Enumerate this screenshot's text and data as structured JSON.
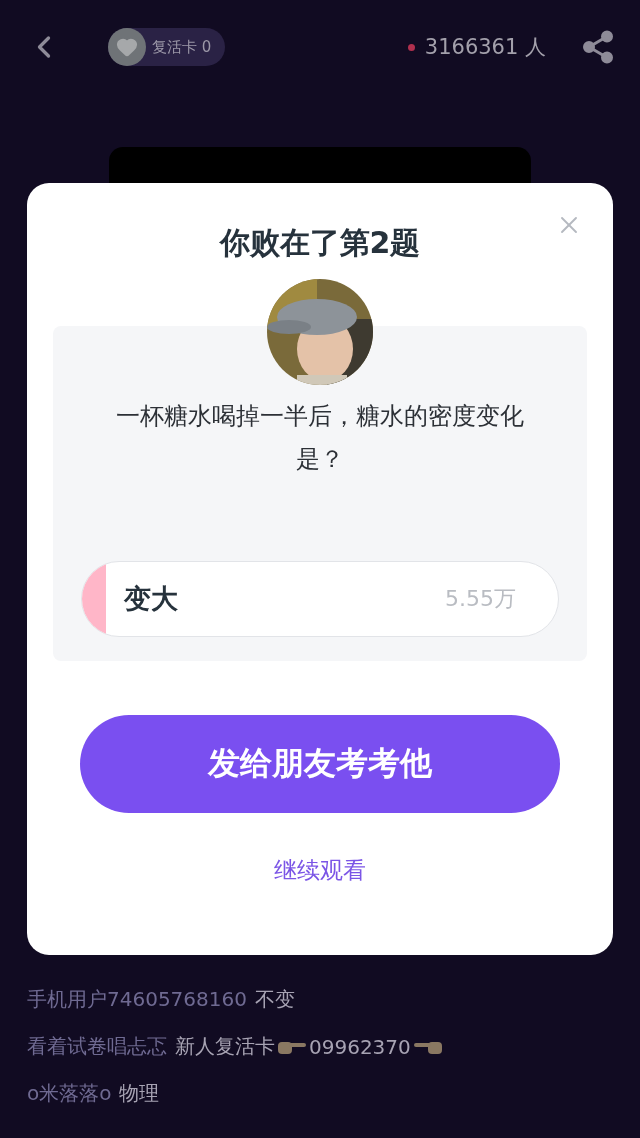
{
  "top_bar": {
    "revive_card": {
      "label": "复活卡",
      "count": "0"
    },
    "viewers": "3166361 人"
  },
  "comments": [
    {
      "user": "手机用户74605768160",
      "parts": [
        {
          "kind": "text",
          "text": "不变"
        }
      ]
    },
    {
      "user": "看着试卷唱忐忑",
      "parts": [
        {
          "kind": "text",
          "text": "新人复活卡"
        },
        {
          "kind": "hand-right"
        },
        {
          "kind": "text",
          "text": "09962370"
        },
        {
          "kind": "hand-left"
        }
      ]
    },
    {
      "user": "o米落落o",
      "parts": [
        {
          "kind": "text",
          "text": "物理"
        }
      ]
    }
  ],
  "dialog": {
    "title": "你败在了第2题",
    "question": "一杯糖水喝掉一半后，糖水的密度变化是？",
    "options": [
      {
        "label": "变大",
        "count": "5.55万",
        "level": 0.05
      }
    ],
    "primary_button": "发给朋友考考他",
    "link": "继续观看"
  }
}
